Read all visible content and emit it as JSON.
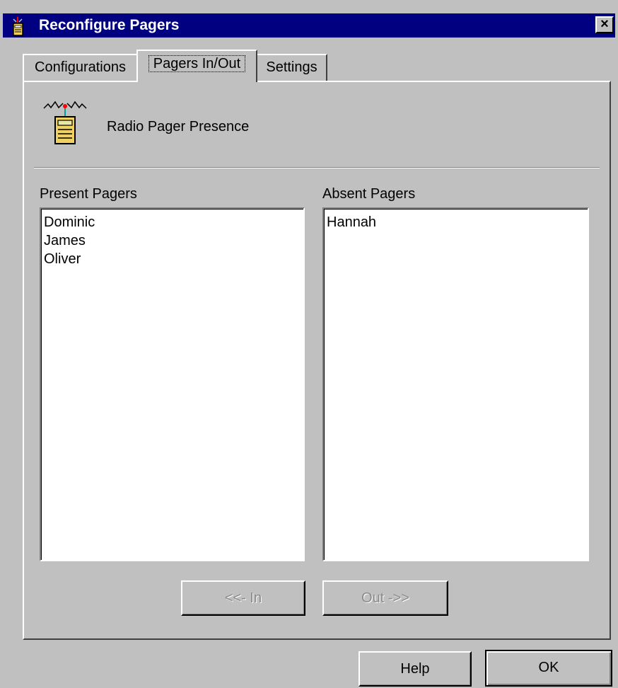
{
  "window": {
    "title": "Reconfigure Pagers",
    "close_label": "×",
    "icon": "pager-app-icon"
  },
  "tabs": [
    {
      "label": "Configurations",
      "active": false
    },
    {
      "label": "Pagers In/Out",
      "active": true
    },
    {
      "label": "Settings",
      "active": false
    }
  ],
  "section": {
    "icon": "radio-pager-icon",
    "title": "Radio Pager Presence"
  },
  "present": {
    "label": "Present Pagers",
    "items": [
      "Dominic",
      "James",
      "Oliver"
    ]
  },
  "absent": {
    "label": "Absent Pagers",
    "items": [
      "Hannah"
    ]
  },
  "buttons": {
    "move_in": "<<- In",
    "move_out": "Out ->>",
    "help": "Help",
    "ok": "OK"
  },
  "colors": {
    "titlebar": "#000080",
    "face": "#c0c0c0",
    "disabled_text": "#8a8a8a"
  }
}
